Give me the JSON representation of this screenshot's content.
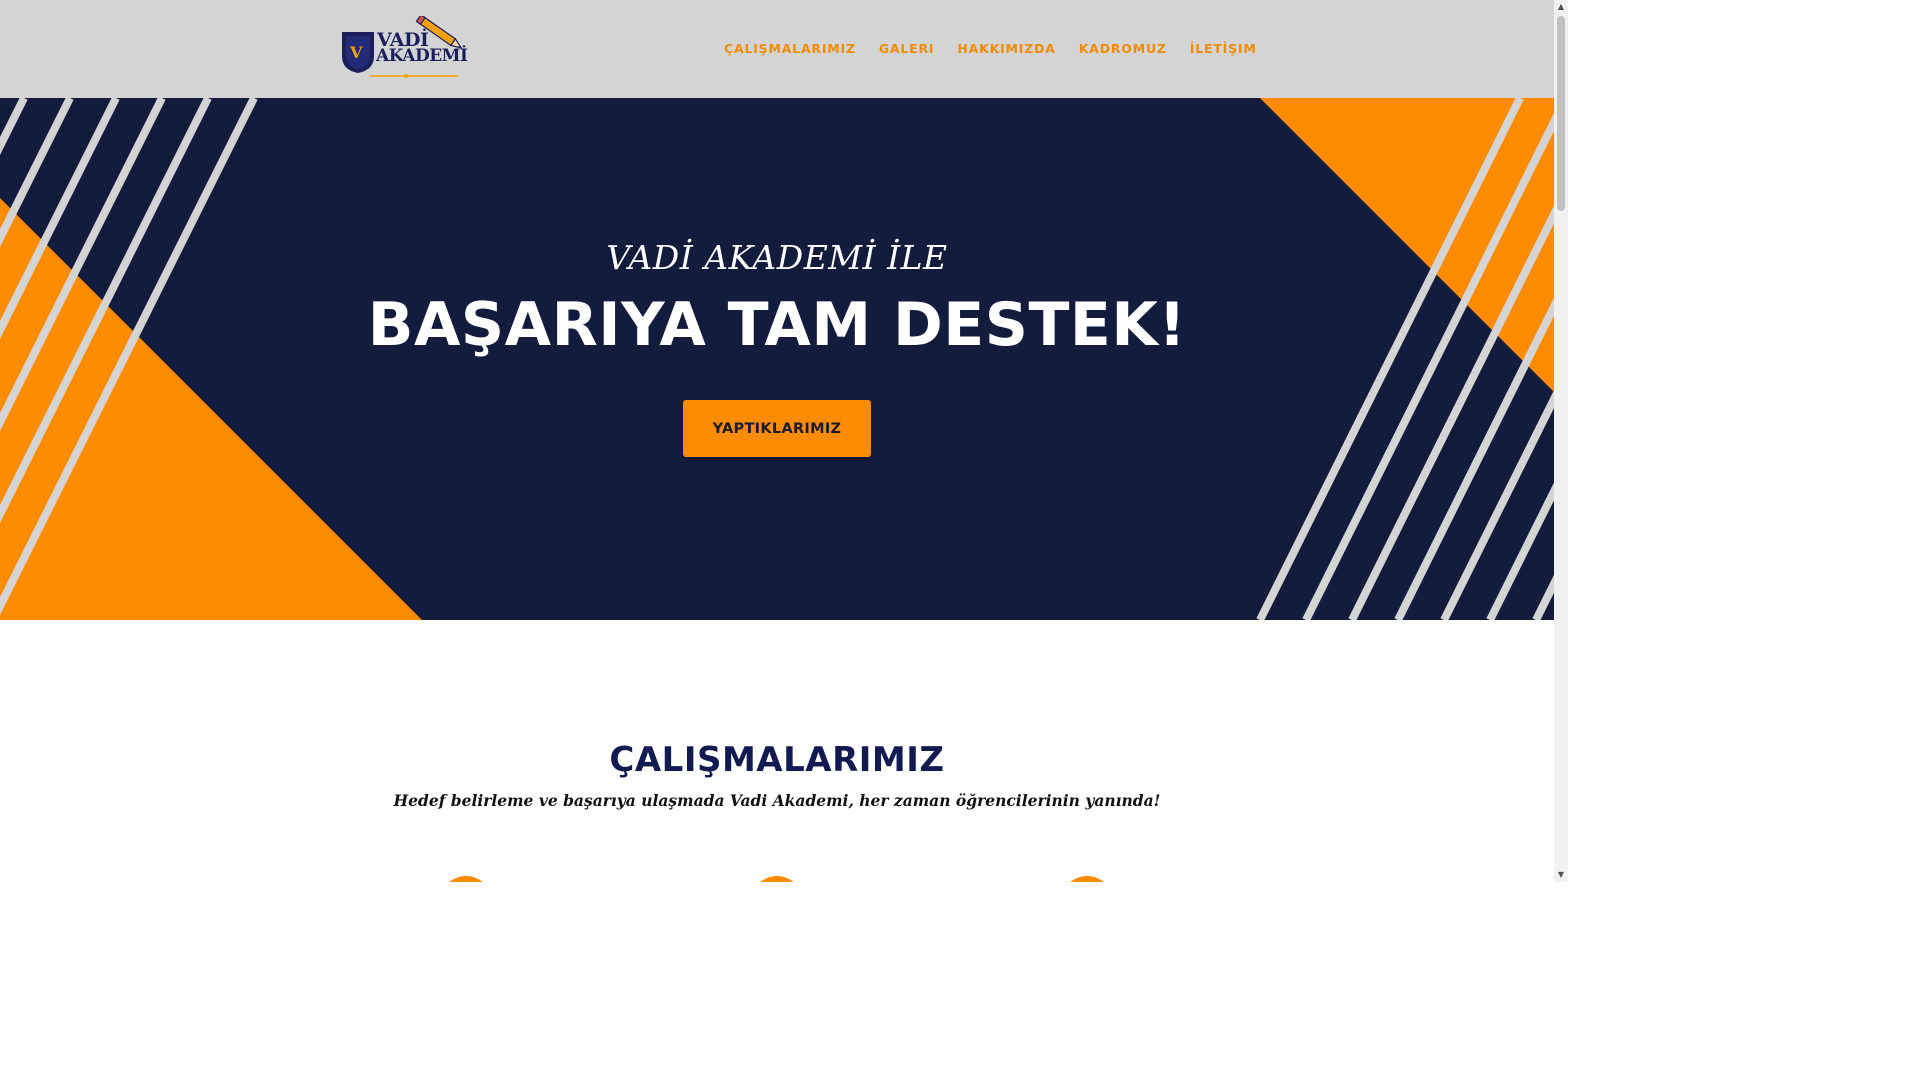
{
  "header": {
    "logo": {
      "line1": "VADİ",
      "line2": "AKADEMİ",
      "shield_letter": "V"
    },
    "nav": [
      {
        "label": "ÇALIŞMALARIMIZ"
      },
      {
        "label": "GALERI"
      },
      {
        "label": "HAKKIMIZDA"
      },
      {
        "label": "KADROMUZ"
      },
      {
        "label": "İLETİŞIM"
      }
    ]
  },
  "hero": {
    "kicker": "VADİ AKADEMİ İLE",
    "title": "BAŞARIYA TAM DESTEK!",
    "button_label": "YAPTIKLARIMIZ"
  },
  "section": {
    "title": "ÇALIŞMALARIMIZ",
    "subtitle": "Hedef belirleme ve başarıya ulaşmada Vadi Akademi, her zaman öğrencilerinin yanında!"
  },
  "colors": {
    "navy": "#131c3d",
    "orange": "#ff8c00",
    "stripe": "#d4d4d4",
    "nav_text": "#f08c00",
    "header_bg": "#d4d4d4"
  },
  "icons": {
    "pencil": "pencil-icon",
    "shield": "shield-icon",
    "scroll_up": "chevron-up-icon",
    "scroll_down": "chevron-down-icon"
  }
}
